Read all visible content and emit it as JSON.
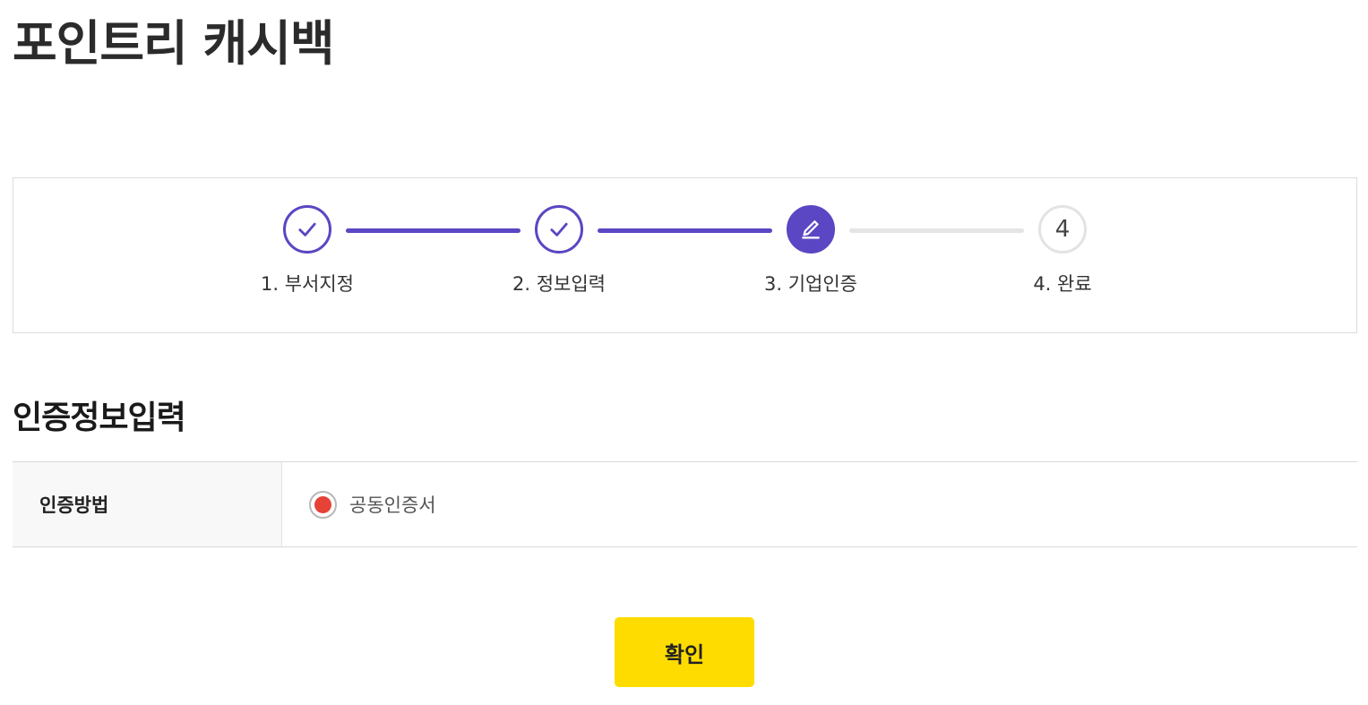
{
  "page": {
    "title": "포인트리 캐시백"
  },
  "stepper": {
    "steps": [
      {
        "label": "1. 부서지정",
        "status": "done",
        "icon": "check-icon"
      },
      {
        "label": "2. 정보입력",
        "status": "done",
        "icon": "check-icon"
      },
      {
        "label": "3. 기업인증",
        "status": "current",
        "icon": "pencil-icon"
      },
      {
        "label": "4. 완료",
        "status": "pending",
        "number": "4"
      }
    ],
    "colors": {
      "active": "#5b46c3",
      "inactive": "#e3e3e3"
    }
  },
  "section": {
    "title": "인증정보입력"
  },
  "form": {
    "auth_method_label": "인증방법",
    "auth_option_label": "공동인증서",
    "auth_option_selected": true,
    "radio_color": "#e64238"
  },
  "actions": {
    "confirm_label": "확인",
    "confirm_color": "#ffdc00"
  }
}
